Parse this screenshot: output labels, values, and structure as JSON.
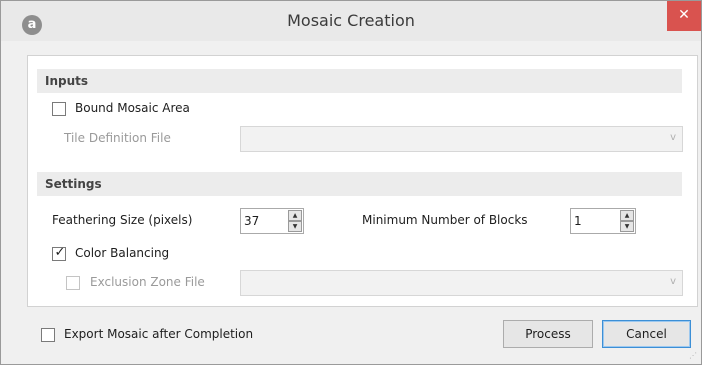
{
  "window": {
    "title": "Mosaic Creation",
    "app_icon_glyph": "a",
    "close_glyph": "✕"
  },
  "inputs": {
    "header": "Inputs",
    "bound_mosaic_area": {
      "label": "Bound Mosaic Area",
      "checked": false
    },
    "tile_definition_file": {
      "label": "Tile Definition File",
      "value": "",
      "enabled": false
    }
  },
  "settings": {
    "header": "Settings",
    "feathering_size": {
      "label": "Feathering Size (pixels)",
      "value": "37"
    },
    "minimum_blocks": {
      "label": "Minimum Number of Blocks",
      "value": "1"
    },
    "color_balancing": {
      "label": "Color Balancing",
      "checked": true,
      "check_glyph": "✓"
    },
    "exclusion_zone_file": {
      "label": "Exclusion Zone File",
      "value": "",
      "enabled": false,
      "checked": false
    }
  },
  "footer": {
    "export_mosaic": {
      "label": "Export Mosaic after Completion",
      "checked": false
    },
    "process_label": "Process",
    "cancel_label": "Cancel"
  },
  "icons": {
    "up_arrow": "▲",
    "down_arrow": "▼",
    "dropdown_arrow": "v"
  },
  "colors": {
    "close_button": "#d9534f",
    "default_button_border": "#3c8fd6",
    "section_header_bg": "#ececec"
  }
}
